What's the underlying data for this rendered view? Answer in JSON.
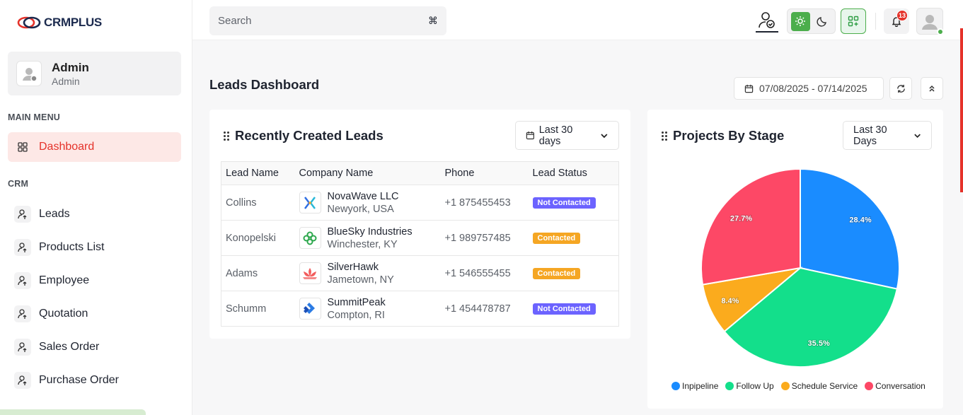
{
  "brand": {
    "name": "CRMPLUS"
  },
  "search": {
    "placeholder": "Search",
    "shortcut": "⌘"
  },
  "user": {
    "name": "Admin",
    "role": "Admin"
  },
  "notifications": {
    "count": "13"
  },
  "sidebar": {
    "main_menu_label": "MAIN MENU",
    "crm_label": "CRM",
    "dashboard": "Dashboard",
    "items": [
      "Leads",
      "Products List",
      "Employee",
      "Quotation",
      "Sales Order",
      "Purchase Order"
    ]
  },
  "page": {
    "title": "Leads Dashboard",
    "date_range": "07/08/2025 - 07/14/2025"
  },
  "leads_card": {
    "title": "Recently Created Leads",
    "filter": "Last 30 days",
    "columns": [
      "Lead Name",
      "Company Name",
      "Phone",
      "Lead Status"
    ],
    "rows": [
      {
        "lead": "Collins",
        "company": "NovaWave LLC",
        "location": "Newyork, USA",
        "phone": "+1 875455453",
        "status": "Not Contacted",
        "status_color": "#6c63ff",
        "logo": "novawave-logo"
      },
      {
        "lead": "Konopelski",
        "company": "BlueSky Industries",
        "location": "Winchester, KY",
        "phone": "+1 989757485",
        "status": "Contacted",
        "status_color": "#f5a623",
        "logo": "bluesky-logo"
      },
      {
        "lead": "Adams",
        "company": "SilverHawk",
        "location": "Jametown, NY",
        "phone": "+1 546555455",
        "status": "Contacted",
        "status_color": "#f5a623",
        "logo": "silverhawk-logo"
      },
      {
        "lead": "Schumm",
        "company": "SummitPeak",
        "location": "Compton, RI",
        "phone": "+1 454478787",
        "status": "Not Contacted",
        "status_color": "#6c63ff",
        "logo": "summitpeak-logo"
      }
    ]
  },
  "stage_card": {
    "title": "Projects By Stage",
    "filter": "Last 30 Days"
  },
  "chart_data": {
    "type": "pie",
    "title": "Projects By Stage",
    "legend_position": "bottom",
    "slices": [
      {
        "name": "Inpipeline",
        "value": 28.4,
        "label": "28.4%",
        "color": "#1a8cff"
      },
      {
        "name": "Follow Up",
        "value": 35.5,
        "label": "35.5%",
        "color": "#13df8b"
      },
      {
        "name": "Schedule Service",
        "value": 8.4,
        "label": "8.4%",
        "color": "#fbab1d"
      },
      {
        "name": "Conversation",
        "value": 27.7,
        "label": "27.7%",
        "color": "#fd4866"
      }
    ]
  }
}
